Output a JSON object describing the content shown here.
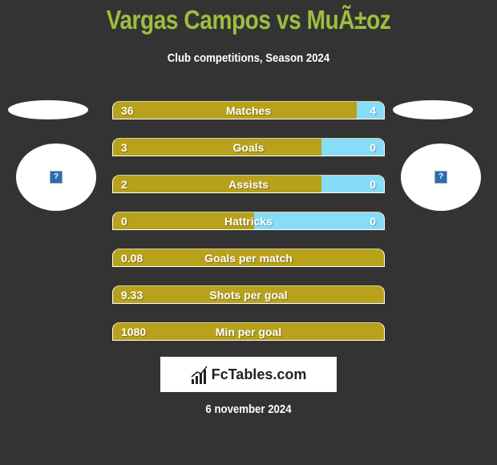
{
  "header": {
    "title": "Vargas Campos vs MuÃ±oz",
    "subtitle": "Club competitions, Season 2024"
  },
  "players": {
    "left": {
      "avatar_icon": "question-icon",
      "avatar_glyph": "?"
    },
    "right": {
      "avatar_icon": "question-icon",
      "avatar_glyph": "?"
    }
  },
  "colors": {
    "left": "#b8a11b",
    "right": "#87dcf7",
    "title": "#9dbe3e",
    "background": "#333333"
  },
  "stats": [
    {
      "label": "Matches",
      "left": "36",
      "right": "4",
      "left_share": 0.9
    },
    {
      "label": "Goals",
      "left": "3",
      "right": "0",
      "left_share": 0.77
    },
    {
      "label": "Assists",
      "left": "2",
      "right": "0",
      "left_share": 0.77
    },
    {
      "label": "Hattricks",
      "left": "0",
      "right": "0",
      "left_share": 0.52
    },
    {
      "label": "Goals per match",
      "left": "0.08",
      "right": "",
      "left_share": 1.0
    },
    {
      "label": "Shots per goal",
      "left": "9.33",
      "right": "",
      "left_share": 1.0
    },
    {
      "label": "Min per goal",
      "left": "1080",
      "right": "",
      "left_share": 1.0
    }
  ],
  "footer": {
    "logo_text": "FcTables.com",
    "logo_icon": "bar-chart-icon",
    "date": "6 november 2024"
  }
}
